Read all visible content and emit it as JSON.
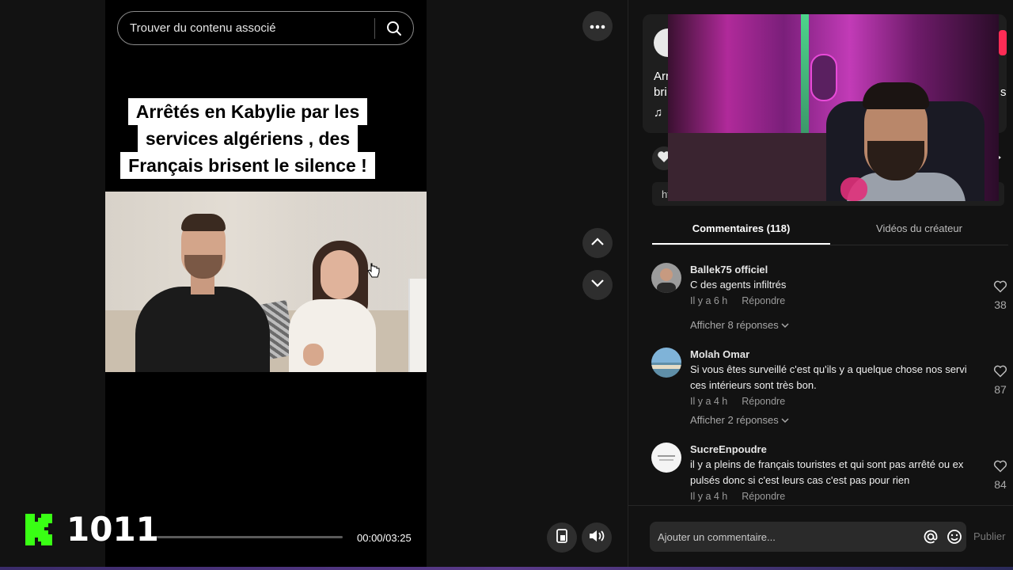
{
  "search": {
    "placeholder": "Trouver du contenu associé"
  },
  "caption": {
    "line1": "Arrêtés en Kabylie par les",
    "line2": "services algériens , des",
    "line3": "Français brisent le silence !"
  },
  "player": {
    "time": "00:00/03:25",
    "progress": 0.0
  },
  "overlay": {
    "counter": "1011",
    "accent": "#39ff14"
  },
  "tabs": {
    "comments": "Commentaires (118)",
    "creator_videos": "Vidéos du créateur"
  },
  "comments": [
    {
      "user": "Ballek75 officiel",
      "text": "C des agents infiltrés",
      "time": "Il y a 6 h",
      "reply": "Répondre",
      "likes": "38",
      "more_replies": "Afficher 8 réponses"
    },
    {
      "user": "Molah Omar",
      "text": "Si vous êtes surveillé c'est qu'ils y a quelque chose nos servi ces intérieurs sont très bon.",
      "time": "Il y a 4 h",
      "reply": "Répondre",
      "likes": "87",
      "more_replies": "Afficher 2 réponses"
    },
    {
      "user": "SucreEnpoudre",
      "text": "il y a pleins de français touristes et qui sont pas arrêté ou ex pulsés donc si c'est leurs cas c'est pas pour rien",
      "time": "Il y a 4 h",
      "reply": "Répondre",
      "likes": "84"
    }
  ],
  "comment_bar": {
    "placeholder": "Ajouter un commentaire...",
    "publish": "Publier"
  },
  "panel_partial": {
    "title_a": "Arr",
    "title_b": "bri",
    "title_c": "s",
    "link": "ht",
    "music": "♫"
  },
  "colors": {
    "accent_red": "#fe2c55",
    "background": "#121212"
  }
}
